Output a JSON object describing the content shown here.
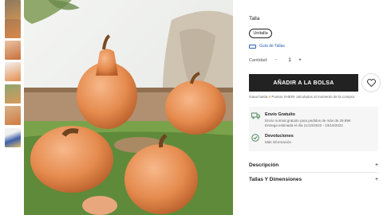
{
  "thumbnails": [
    {
      "name": "thumb-1",
      "bg": "#b78d5a"
    },
    {
      "name": "thumb-2",
      "bg": "#c98550"
    },
    {
      "name": "thumb-3",
      "bg": "#d2874c"
    },
    {
      "name": "thumb-4",
      "bg": "#e5955a"
    },
    {
      "name": "thumb-5",
      "bg": "#cfa071"
    },
    {
      "name": "thumb-6",
      "bg": "#d9874b"
    },
    {
      "name": "thumb-7",
      "bg": "#3d5ea8"
    }
  ],
  "size": {
    "label": "Talla",
    "selected": "Unitalla",
    "guide": "Guía de Tallas"
  },
  "quantity": {
    "label": "Cantidad:",
    "minus": "−",
    "value": "1",
    "plus": "+"
  },
  "add_to_bag": "AÑADIR A LA BOLSA",
  "points_prefix": "Gana hasta",
  "points_value": "8",
  "points_suffix": "Puntos SHEIN calculados al momento de la compra.",
  "shipping": {
    "title": "Envío Gratuito",
    "line1": "Envío normal gratuito para pedidos de más de 29.99€",
    "line2": "Entrega estimada el día 21/10/2022 - 23/10/2022"
  },
  "returns": {
    "title": "Devoluciones",
    "line1": "Más información"
  },
  "sections": [
    {
      "label": "Descripción",
      "toggle": "+"
    },
    {
      "label": "Tallas Y Dimensiones",
      "toggle": "+"
    }
  ],
  "colors": {
    "accent": "#222222",
    "link": "#2a60b8",
    "points": "#c68a1e",
    "panel_bg": "#f6f6f6",
    "check": "#4f8a5a"
  }
}
